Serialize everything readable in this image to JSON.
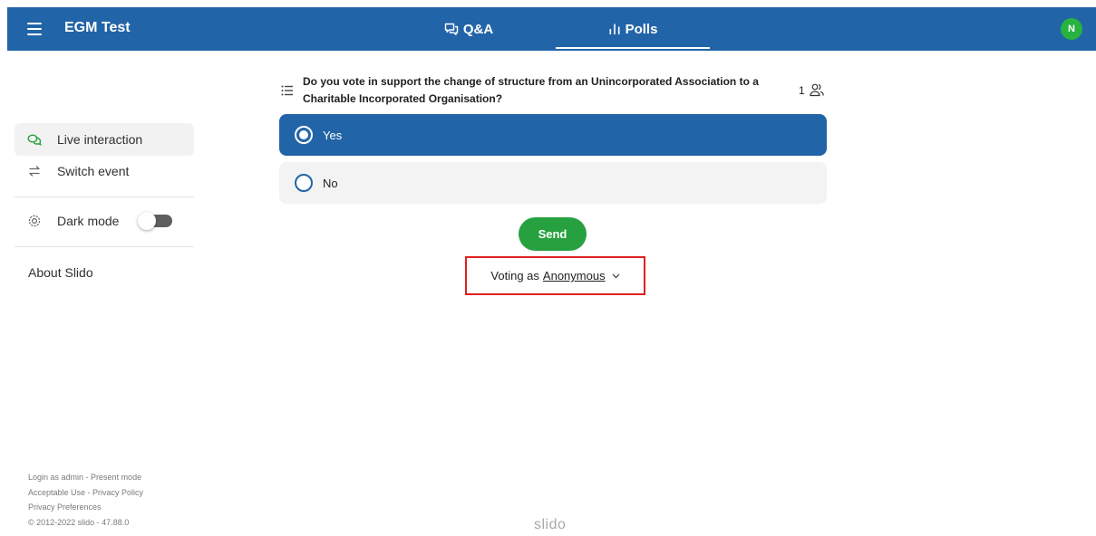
{
  "header": {
    "event_title": "EGM Test",
    "tabs": [
      {
        "label": "Q&A",
        "icon": "chat-bubbles-icon",
        "active": false
      },
      {
        "label": "Polls",
        "icon": "bar-chart-icon",
        "active": true
      }
    ],
    "avatar_initial": "N",
    "accent_color": "#2264a8",
    "avatar_color": "#26b33f"
  },
  "sidebar": {
    "items": [
      {
        "label": "Live interaction",
        "icon": "chat-bubbles-icon",
        "active": true
      },
      {
        "label": "Switch event",
        "icon": "swap-arrows-icon",
        "active": false
      }
    ],
    "dark_mode": {
      "label": "Dark mode",
      "icon": "gear-icon",
      "enabled": false
    },
    "about": "About Slido"
  },
  "footer": {
    "line1_a": "Login as admin",
    "line1_sep": " - ",
    "line1_b": "Present mode",
    "line2_a": "Acceptable Use",
    "line2_sep": " - ",
    "line2_b": "Privacy Policy",
    "line3": "Privacy Preferences",
    "copyright": "© 2012-2022 slido - 47.88.0"
  },
  "poll": {
    "question": "Do you vote in support the change of structure from an Unincorporated Association to a Charitable Incorporated Organisation?",
    "participants": "1",
    "options": [
      {
        "label": "Yes",
        "selected": true
      },
      {
        "label": "No",
        "selected": false
      }
    ],
    "send_label": "Send",
    "voting_as_prefix": "Voting as",
    "voting_as_name": "Anonymous",
    "send_color": "#27a140",
    "highlight_color": "#e02020"
  },
  "brand": "slido"
}
